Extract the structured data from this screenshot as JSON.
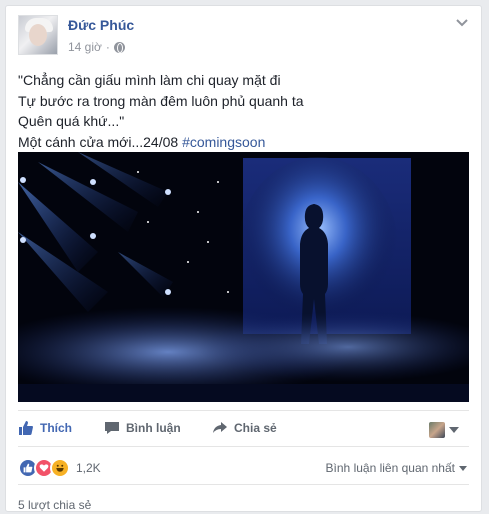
{
  "post": {
    "author": "Đức Phúc",
    "time": "14 giờ",
    "separator": "·",
    "text_lines": [
      "\"Chẳng cần giấu mình làm chi quay mặt đi",
      "Tự bước ra trong màn đêm luôn phủ quanh ta",
      "Quên quá khứ...\""
    ],
    "last_line_text": "Một cánh cửa mới...24/08 ",
    "hashtag": "#comingsoon"
  },
  "actions": {
    "like": "Thích",
    "comment": "Bình luận",
    "share": "Chia sẻ"
  },
  "stats": {
    "reaction_count": "1,2K",
    "comment_sort": "Bình luận liên quan nhất",
    "shares": "5 lượt chia sẻ"
  },
  "icons": {
    "post_menu": "chevron-down-icon",
    "privacy": "globe-icon",
    "like": "thumbs-up-icon",
    "comment": "speech-bubble-icon",
    "share": "share-arrow-icon",
    "reactions": [
      "like-reaction-icon",
      "love-reaction-icon",
      "haha-reaction-icon"
    ]
  },
  "colors": {
    "link_blue": "#365899",
    "action_blue": "#4267b2",
    "love_red": "#f25268",
    "haha_yellow": "#f7b125",
    "text": "#1d2129",
    "muted": "#90949c"
  }
}
